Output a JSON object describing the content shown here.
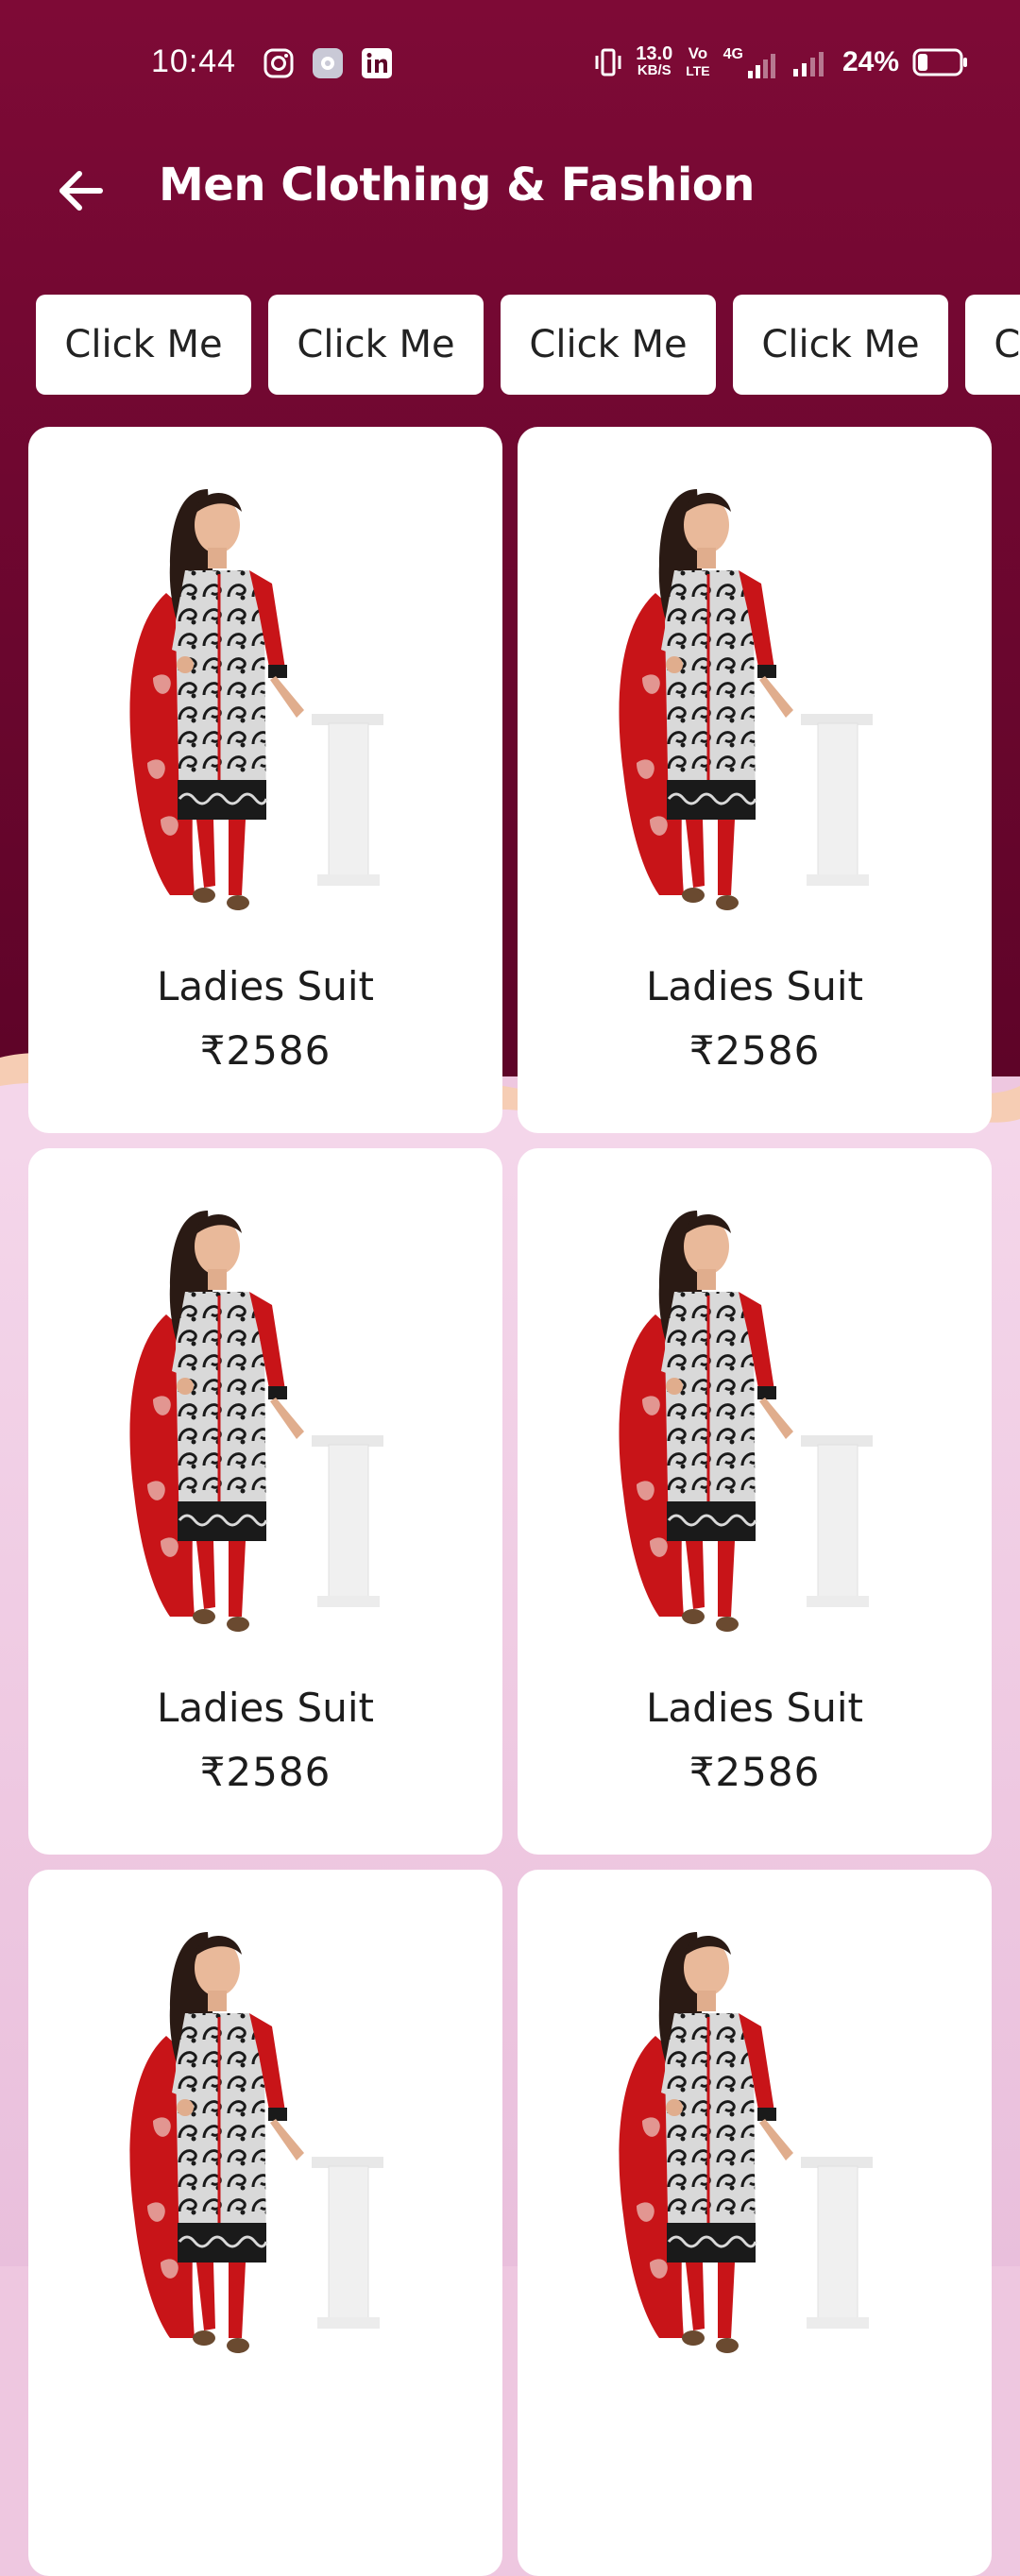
{
  "status_bar": {
    "time": "10:44",
    "net_speed_value": "13.0",
    "net_speed_unit": "KB/S",
    "volte_top": "Vo",
    "volte_bottom": "LTE",
    "network_label": "4G",
    "battery": "24%",
    "battery_level": 0.24,
    "left_icons": [
      "instagram-icon",
      "settings-app-icon",
      "linkedin-icon"
    ]
  },
  "app_bar": {
    "title": "Men Clothing & Fashion",
    "back_icon": "arrow-left-icon"
  },
  "chips": [
    "Click Me",
    "Click Me",
    "Click Me",
    "Click Me",
    "Click Me"
  ],
  "products": [
    {
      "name": "Ladies Suit",
      "price": "₹2586"
    },
    {
      "name": "Ladies Suit",
      "price": "₹2586"
    },
    {
      "name": "Ladies Suit",
      "price": "₹2586"
    },
    {
      "name": "Ladies Suit",
      "price": "₹2586"
    },
    {
      "name": "",
      "price": ""
    },
    {
      "name": "",
      "price": ""
    }
  ],
  "colors": {
    "header_bg": "#7e0a36",
    "page_bg": "#eec8e1",
    "card_bg": "#ffffff",
    "text_dark": "#1c1c1c"
  }
}
